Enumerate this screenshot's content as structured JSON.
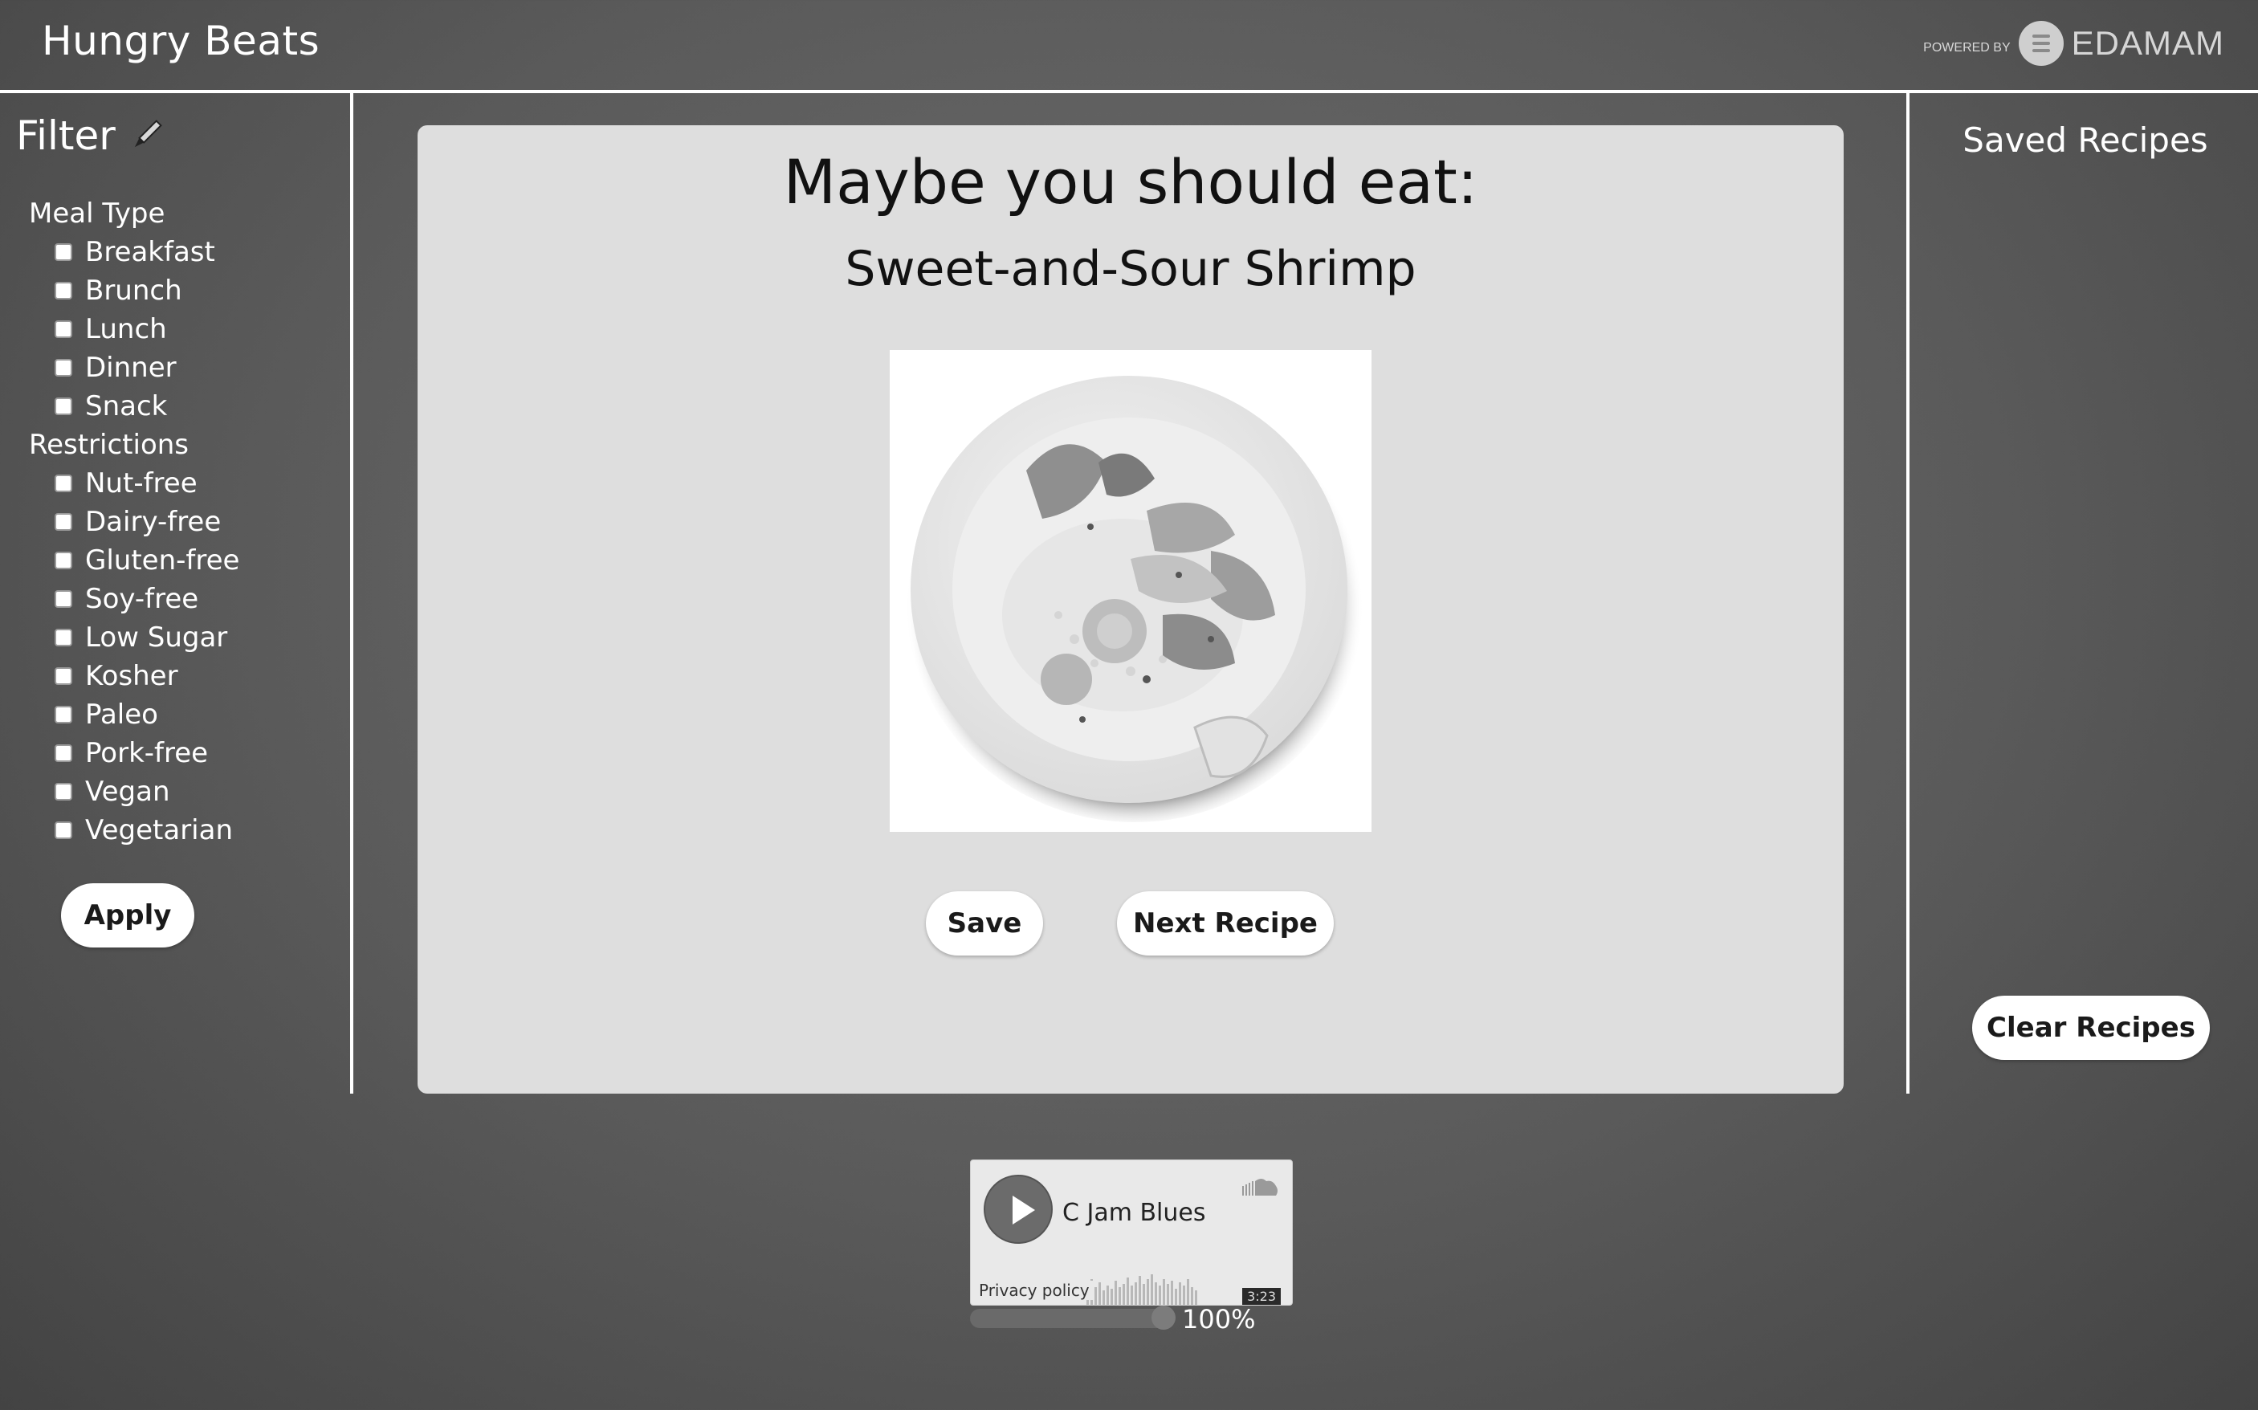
{
  "header": {
    "title": "Hungry Beats",
    "powered_by": "POWERED BY",
    "brand": "EDAMAM"
  },
  "filter": {
    "title": "Filter",
    "icon": "pen-icon",
    "meal_type_label": "Meal Type",
    "meal_types": [
      "Breakfast",
      "Brunch",
      "Lunch",
      "Dinner",
      "Snack"
    ],
    "restrictions_label": "Restrictions",
    "restrictions": [
      "Nut-free",
      "Dairy-free",
      "Gluten-free",
      "Soy-free",
      "Low Sugar",
      "Kosher",
      "Paleo",
      "Pork-free",
      "Vegan",
      "Vegetarian"
    ],
    "apply_label": "Apply"
  },
  "main": {
    "headline": "Maybe you should eat:",
    "recipe_name": "Sweet-and-Sour Shrimp",
    "save_label": "Save",
    "next_label": "Next Recipe"
  },
  "saved": {
    "title": "Saved Recipes",
    "clear_label": "Clear Recipes"
  },
  "player": {
    "track": "C Jam Blues",
    "privacy": "Privacy policy",
    "duration": "3:23",
    "volume": "100%",
    "volume_level": 1.0
  }
}
